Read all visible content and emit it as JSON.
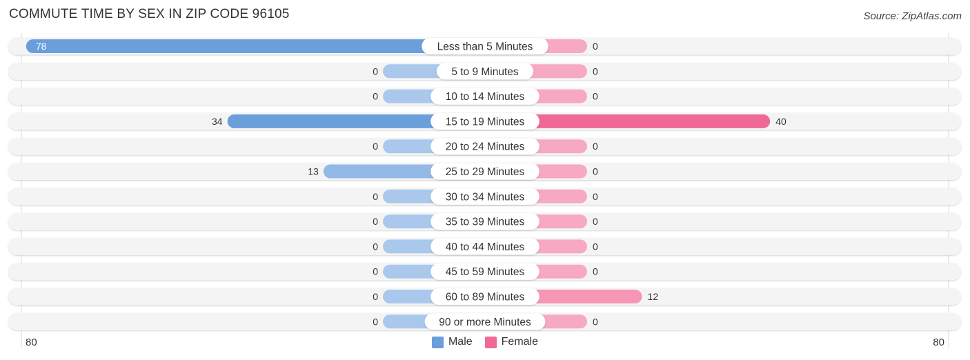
{
  "chart_data": {
    "type": "bar",
    "orientation": "horizontal-diverging",
    "title": "COMMUTE TIME BY SEX IN ZIP CODE 96105",
    "source": "Source: ZipAtlas.com",
    "categories": [
      "Less than 5 Minutes",
      "5 to 9 Minutes",
      "10 to 14 Minutes",
      "15 to 19 Minutes",
      "20 to 24 Minutes",
      "25 to 29 Minutes",
      "30 to 34 Minutes",
      "35 to 39 Minutes",
      "40 to 44 Minutes",
      "45 to 59 Minutes",
      "60 to 89 Minutes",
      "90 or more Minutes"
    ],
    "series": [
      {
        "name": "Male",
        "color": "#6a9fdc",
        "light_color": "#a9c8ec",
        "values": [
          78,
          0,
          0,
          34,
          0,
          13,
          0,
          0,
          0,
          0,
          0,
          0
        ]
      },
      {
        "name": "Female",
        "color": "#f06895",
        "light_color": "#f7a8c2",
        "values": [
          0,
          0,
          0,
          40,
          0,
          0,
          0,
          0,
          0,
          0,
          12,
          0
        ]
      }
    ],
    "axis": {
      "left_label": "80",
      "right_label": "80",
      "max": 80
    },
    "legend": {
      "position": "bottom-center",
      "items": [
        "Male",
        "Female"
      ]
    }
  }
}
